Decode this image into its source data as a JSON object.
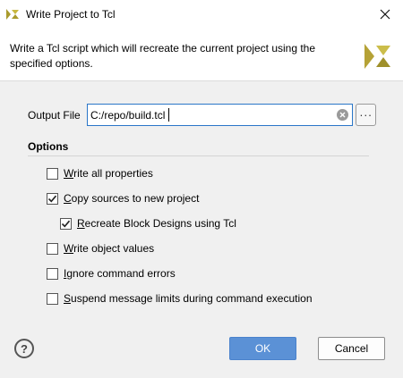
{
  "window": {
    "title": "Write Project to Tcl",
    "app_icon": "vivado-logo-icon",
    "close_icon": "close-icon"
  },
  "header": {
    "description": "Write a Tcl script which will recreate the current project using the specified options.",
    "logo_icon": "vivado-logo-icon"
  },
  "output_file": {
    "label": "Output File",
    "value": "C:/repo/build.tcl",
    "browse_label": "···"
  },
  "options": {
    "title": "Options",
    "items": [
      {
        "pre": "",
        "ul": "W",
        "post": "rite all properties",
        "checked": false
      },
      {
        "pre": "",
        "ul": "C",
        "post": "opy sources to new project",
        "checked": true
      },
      {
        "pre": "",
        "ul": "R",
        "post": "ecreate Block Designs using Tcl",
        "checked": true
      },
      {
        "pre": "",
        "ul": "W",
        "post": "rite object values",
        "checked": false
      },
      {
        "pre": "",
        "ul": "I",
        "post": "gnore command errors",
        "checked": false
      },
      {
        "pre": "",
        "ul": "S",
        "post": "uspend message limits during command execution",
        "checked": false
      }
    ]
  },
  "buttons": {
    "help": "?",
    "ok": "OK",
    "cancel": "Cancel"
  },
  "colors": {
    "accent": "#5b91d6",
    "focus_border": "#2a76c8",
    "logo_gold": "#b5a236"
  }
}
